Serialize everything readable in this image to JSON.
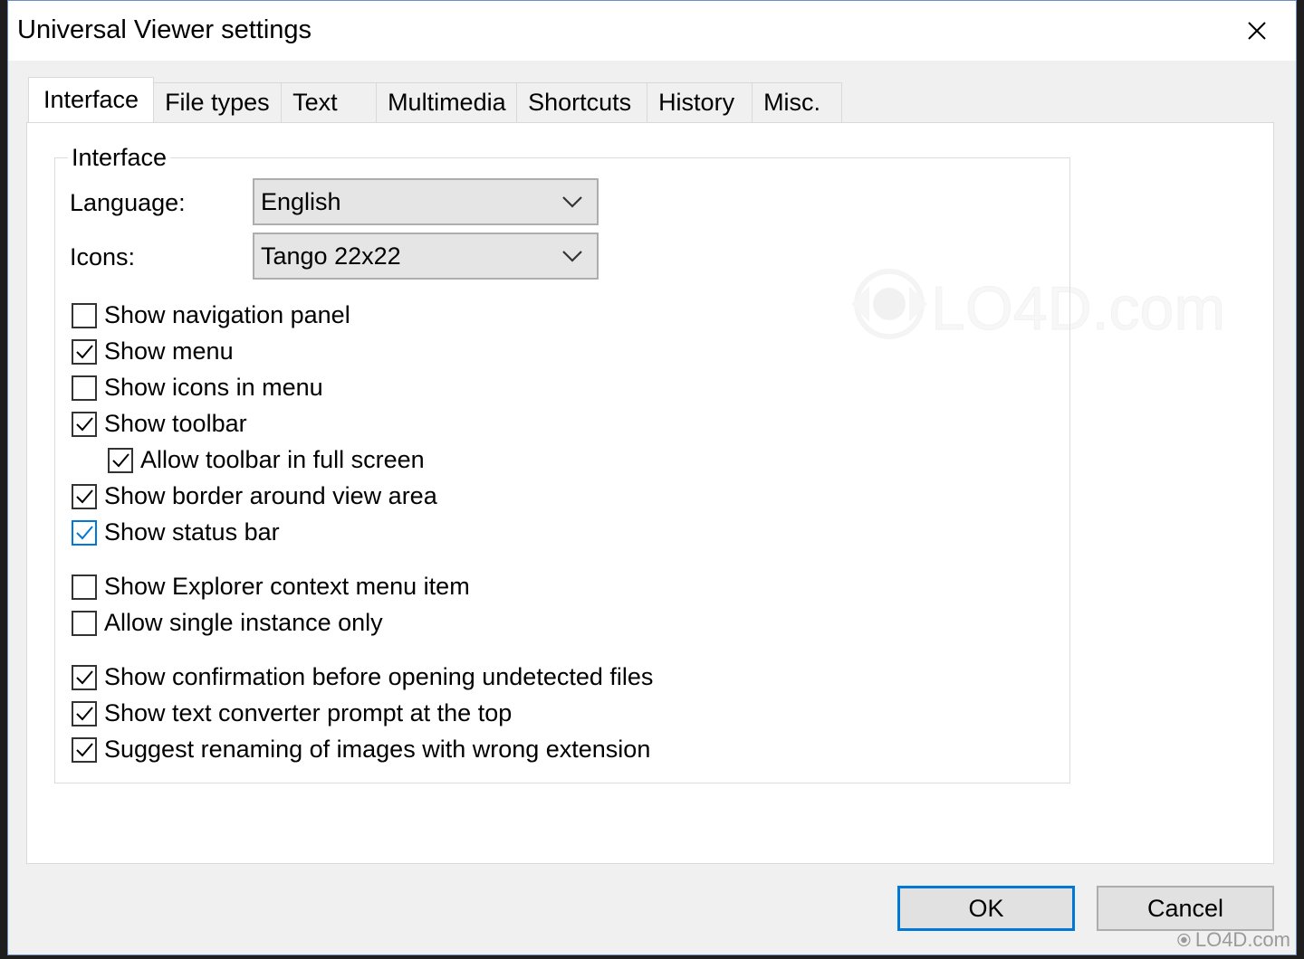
{
  "window": {
    "title": "Universal Viewer settings"
  },
  "tabs": [
    {
      "label": "Interface",
      "active": true
    },
    {
      "label": "File types",
      "active": false
    },
    {
      "label": "Text",
      "active": false
    },
    {
      "label": "Multimedia",
      "active": false
    },
    {
      "label": "Shortcuts",
      "active": false
    },
    {
      "label": "History",
      "active": false
    },
    {
      "label": "Misc.",
      "active": false
    }
  ],
  "group": {
    "legend": "Interface"
  },
  "language": {
    "label": "Language:",
    "value": "English"
  },
  "icons": {
    "label": "Icons:",
    "value": "Tango 22x22"
  },
  "options": [
    {
      "label": "Show navigation panel",
      "checked": false
    },
    {
      "label": "Show menu",
      "checked": true
    },
    {
      "label": "Show icons in menu",
      "checked": false
    },
    {
      "label": "Show toolbar",
      "checked": true
    },
    {
      "label": "Allow toolbar in full screen",
      "checked": true
    },
    {
      "label": "Show border around view area",
      "checked": true
    },
    {
      "label": "Show status bar",
      "checked": true
    },
    {
      "label": "Show Explorer context menu item",
      "checked": false
    },
    {
      "label": "Allow single instance only",
      "checked": false
    },
    {
      "label": "Show confirmation before opening undetected files",
      "checked": true
    },
    {
      "label": "Show text converter prompt at the top",
      "checked": true
    },
    {
      "label": "Suggest renaming of images with wrong extension",
      "checked": true
    }
  ],
  "buttons": {
    "ok": "OK",
    "cancel": "Cancel"
  },
  "watermark": {
    "text": "LO4D.com",
    "corner_text": "LO4D.com"
  },
  "colors": {
    "accent": "#0078d7",
    "border": "#adadad",
    "panel": "#ffffff",
    "window": "#f0f0f0"
  }
}
